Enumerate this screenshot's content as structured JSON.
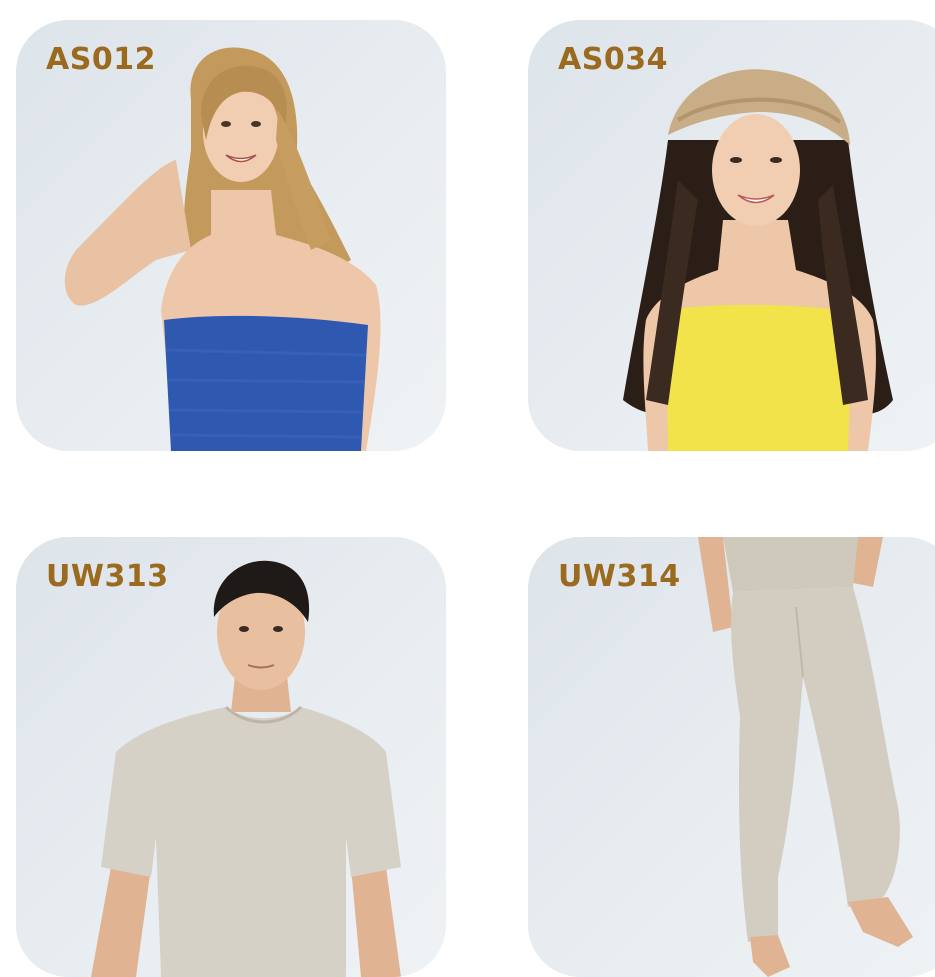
{
  "accent_color": "#9a6a1f",
  "products": [
    {
      "code": "AS012",
      "garment": "blue strapless tube top",
      "garment_color": "#2f59b0"
    },
    {
      "code": "AS034",
      "garment": "yellow strapless tube top",
      "garment_color": "#f3e34a"
    },
    {
      "code": "UW313",
      "garment": "beige short-sleeve t-shirt",
      "garment_color": "#d6d1c6"
    },
    {
      "code": "UW314",
      "garment": "beige long pants",
      "garment_color": "#d3cdc1"
    }
  ]
}
